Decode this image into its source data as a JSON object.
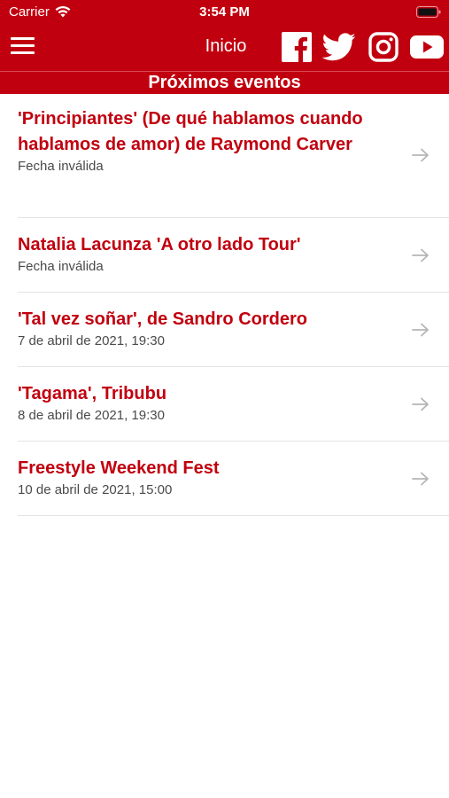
{
  "status_bar": {
    "carrier": "Carrier",
    "time": "3:54 PM",
    "wifi_icon": "wifi-icon",
    "battery_icon": "battery-icon"
  },
  "nav": {
    "title": "Inicio",
    "menu_icon": "hamburger-menu-icon",
    "social_icons": [
      "facebook-icon",
      "twitter-icon",
      "instagram-icon",
      "youtube-icon"
    ]
  },
  "section": {
    "title": "Próximos eventos"
  },
  "events": [
    {
      "title": "'Principiantes' (De qué hablamos cuando hablamos de amor) de Raymond Carver",
      "date": "Fecha inválida"
    },
    {
      "title": "Natalia Lacunza 'A otro lado Tour'",
      "date": "Fecha inválida"
    },
    {
      "title": "'Tal vez soñar', de Sandro Cordero",
      "date": "7 de abril de 2021, 19:30"
    },
    {
      "title": "'Tagama', Tribubu",
      "date": "8 de abril de 2021, 19:30"
    },
    {
      "title": "Freestyle Weekend Fest",
      "date": "10 de abril de 2021, 15:00"
    }
  ],
  "colors": {
    "brand_red": "#c1000f",
    "date_text": "#4a4a4a",
    "chevron": "#b5b5b5",
    "divider": "#e3e3e3"
  }
}
